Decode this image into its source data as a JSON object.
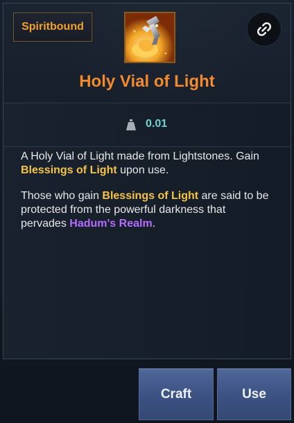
{
  "tooltip": {
    "badge_label": "Spiritbound",
    "item_name": "Holy Vial of Light",
    "weight_value": "0.01",
    "description": {
      "p1_prefix": "A Holy Vial of Light made from Lightstones. Gain ",
      "p1_highlight": "Blessings of Light",
      "p1_suffix": " upon use.",
      "p2_prefix": "Those who gain ",
      "p2_highlight": "Blessings of Light",
      "p2_middle": " are said to be protected from the powerful darkness that pervades ",
      "p2_realm": "Hadum's Realm",
      "p2_suffix": "."
    }
  },
  "actions": {
    "craft_label": "Craft",
    "use_label": "Use"
  },
  "icons": {
    "item": "holy-vial-icon",
    "link": "link-icon",
    "weight": "weight-icon"
  },
  "colors": {
    "item_name": "#f28a2e",
    "badge_text": "#f3a12a",
    "weight_value": "#74d1d1",
    "gold_text": "#f6c545",
    "purple_text": "#b56cff",
    "button": "#465c8f"
  }
}
